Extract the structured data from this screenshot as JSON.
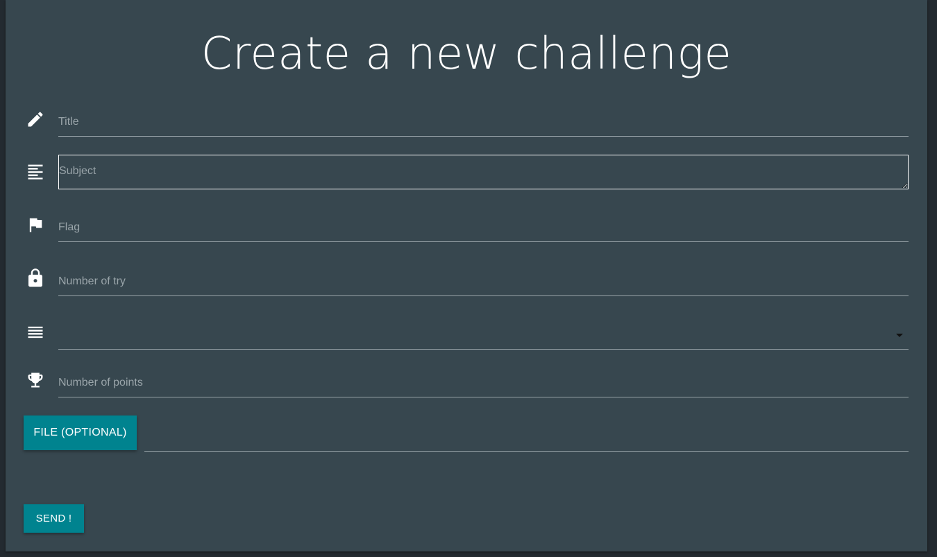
{
  "page": {
    "title": "Create a new challenge"
  },
  "form": {
    "title": {
      "placeholder": "Title",
      "value": "",
      "icon": "pencil-icon"
    },
    "subject": {
      "placeholder": "Subject",
      "value": "",
      "icon": "align-left-icon"
    },
    "flag": {
      "placeholder": "Flag",
      "value": "",
      "icon": "flag-icon"
    },
    "tries": {
      "placeholder": "Number of try",
      "value": "",
      "icon": "lock-icon"
    },
    "category": {
      "selected": "",
      "icon": "list-icon"
    },
    "points": {
      "placeholder": "Number of points",
      "value": "",
      "icon": "trophy-icon"
    },
    "file_button": "FILE (OPTIONAL)",
    "send_button": "SEND !"
  },
  "colors": {
    "card": "#37474f",
    "background": "#232a30",
    "accent": "#00838f",
    "text": "#ffffff",
    "muted": "#9aa5aa"
  }
}
